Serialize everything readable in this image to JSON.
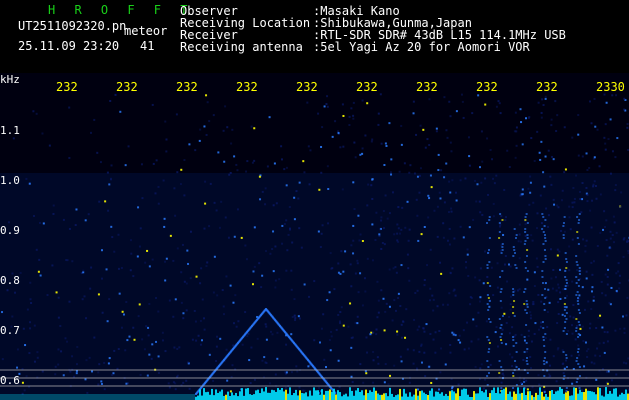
{
  "header": {
    "title": "H R O F F T",
    "file": "UT2511092320.pn",
    "tag": "meteor",
    "date": "25.11.09 23:20",
    "count": "41",
    "info": [
      {
        "label": "Observer",
        "value": ":Masaki Kano"
      },
      {
        "label": "Receiving Location",
        "value": ":Shibukawa,Gunma,Japan"
      },
      {
        "label": "Receiver",
        "value": ":RTL-SDR SDR# 43dB L15 114.1MHz USB"
      },
      {
        "label": "Receiving antenna",
        "value": ":5el Yagi Az 20 for Aomori VOR"
      }
    ]
  },
  "axes": {
    "unit": "kHz",
    "y_ticks": [
      "1.1",
      "1.0",
      "0.9",
      "0.8",
      "0.7",
      "0.6"
    ],
    "x_ticks": [
      "232",
      "232",
      "232",
      "232",
      "232",
      "232",
      "232",
      "232",
      "232",
      "2330"
    ]
  },
  "colors": {
    "background": "#000010",
    "noise": "#0a1a6a",
    "signal": "#2a7bff",
    "strong": "#ffff00",
    "baseline": "#00e0ff"
  }
}
